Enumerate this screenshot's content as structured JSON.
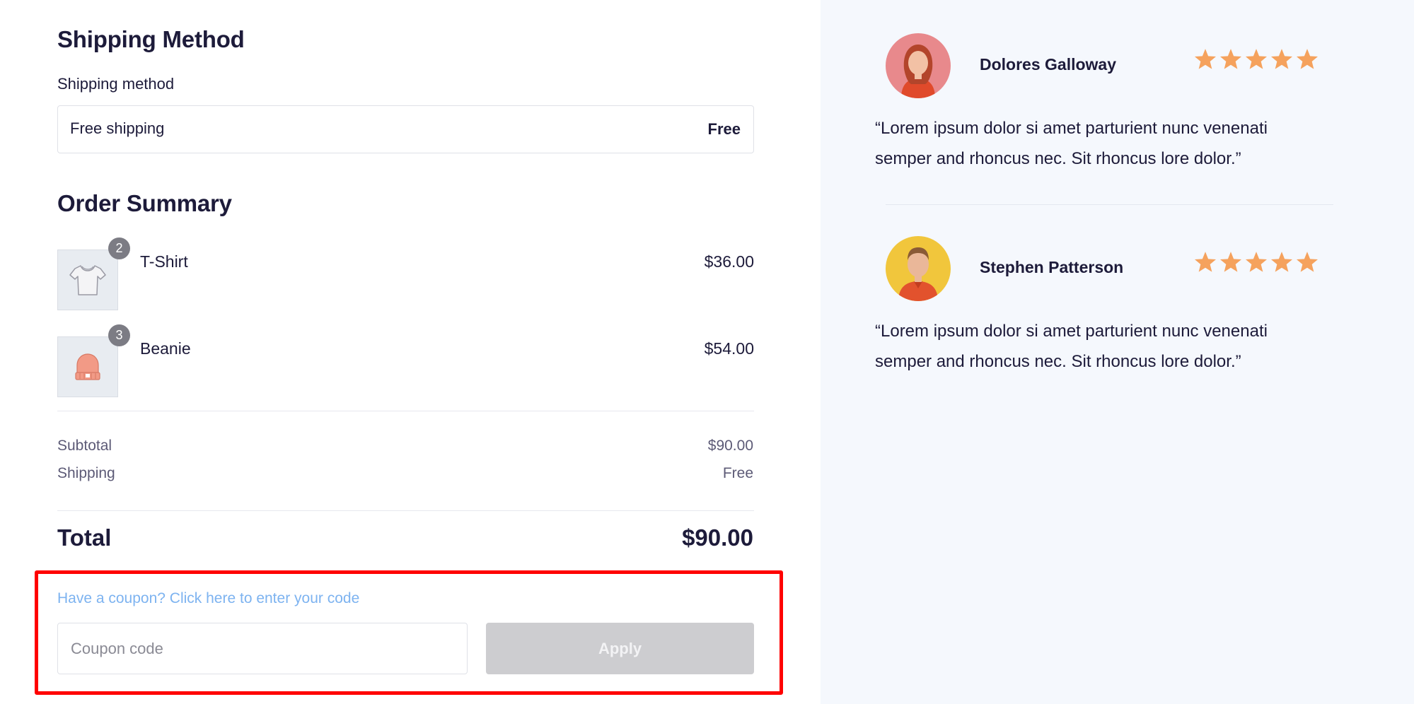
{
  "shipping": {
    "section_title": "Shipping Method",
    "field_label": "Shipping method",
    "selected_name": "Free shipping",
    "selected_price": "Free"
  },
  "order_summary": {
    "section_title": "Order Summary",
    "items": [
      {
        "name": "T-Shirt",
        "quantity": "2",
        "price": "$36.00",
        "icon": "tshirt-icon"
      },
      {
        "name": "Beanie",
        "quantity": "3",
        "price": "$54.00",
        "icon": "beanie-icon"
      }
    ],
    "subtotal_label": "Subtotal",
    "subtotal_value": "$90.00",
    "shipping_label": "Shipping",
    "shipping_value": "Free",
    "total_label": "Total",
    "total_value": "$90.00"
  },
  "coupon": {
    "link_text": "Have a coupon? Click here to enter your code",
    "input_placeholder": "Coupon code",
    "input_value": "",
    "apply_label": "Apply"
  },
  "reviews": [
    {
      "name": "Dolores Galloway",
      "rating": 5,
      "quote": "“Lorem ipsum dolor si amet parturient nunc venenati semper and rhoncus nec. Sit rhoncus lore dolor.”",
      "avatar_bg": "#e8898c"
    },
    {
      "name": "Stephen Patterson",
      "rating": 5,
      "quote": "“Lorem ipsum dolor si amet parturient nunc venenati semper and rhoncus nec. Sit rhoncus lore dolor.”",
      "avatar_bg": "#f1c63c"
    }
  ],
  "colors": {
    "text": "#1d1b3a",
    "muted": "#5c5a76",
    "link": "#7db3f0",
    "star": "#f5a25d",
    "apply_disabled": "#cdcdd0",
    "highlight": "#ff0000",
    "sidebar_bg": "#f5f8fd"
  }
}
